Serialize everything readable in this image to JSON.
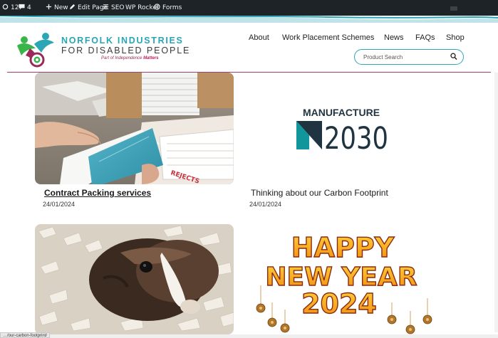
{
  "admin_bar": {
    "comments_count": "12",
    "updates_count": "4",
    "new_label": "New",
    "edit_page_label": "Edit Page",
    "seo_label": "SEO",
    "wp_rocket_label": "WP Rocket",
    "forms_label": "Forms"
  },
  "brand": {
    "line1": "NORFOLK INDUSTRIES",
    "line2": "FOR DISABLED PEOPLE",
    "tagline_prefix": "Part of Independence",
    "tagline_brand": "Matters"
  },
  "nav": {
    "items": [
      "About",
      "Work Placement Schemes",
      "News",
      "FAQs",
      "Shop"
    ]
  },
  "search": {
    "placeholder": "Product Search"
  },
  "posts": [
    {
      "title": "Contract Packing services",
      "date": "24/01/2024"
    },
    {
      "title": "Thinking about our Carbon Footprint",
      "date": "24/01/2024"
    }
  ],
  "images": {
    "manufacture_line1": "MANUFACTURE",
    "manufacture_line2": "2030",
    "rejects_label": "REJECTS",
    "new_year_line1": "HAPPY",
    "new_year_line2": "NEW YEAR",
    "new_year_line3": "2024"
  },
  "status_bar": {
    "url_text": "…/our-carbon-footprint/"
  },
  "colors": {
    "teal": "#2aa6b5",
    "magenta": "#a04070",
    "admin_bar": "#1d2327",
    "manufacture_dark": "#1f3340"
  }
}
